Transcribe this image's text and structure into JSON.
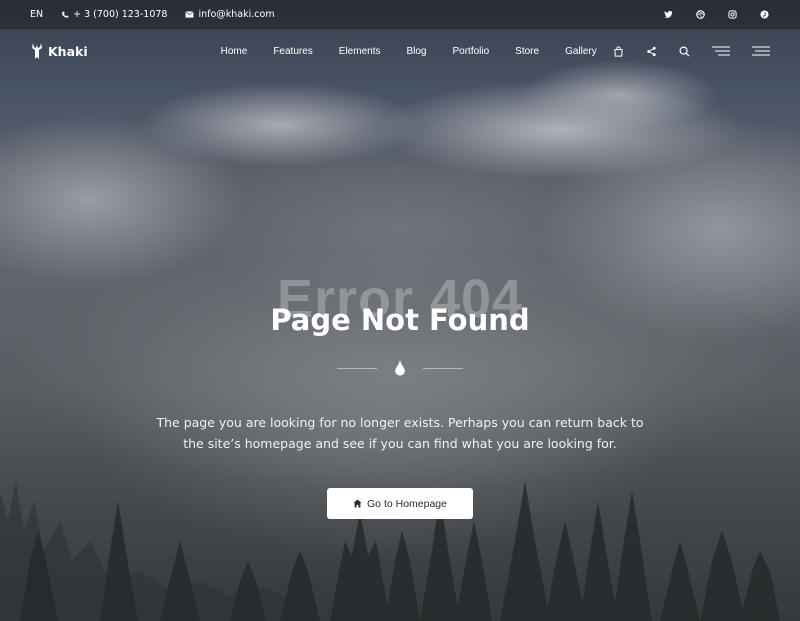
{
  "topbar": {
    "language": "EN",
    "phone": "+ 3 (700) 123-1078",
    "email": "info@khaki.com",
    "social_icons": [
      "twitter-icon",
      "dribbble-icon",
      "instagram-icon",
      "pinterest-icon"
    ]
  },
  "nav": {
    "brand": "Khaki",
    "items": [
      {
        "label": "Home"
      },
      {
        "label": "Features"
      },
      {
        "label": "Elements"
      },
      {
        "label": "Blog"
      },
      {
        "label": "Portfolio"
      },
      {
        "label": "Store"
      },
      {
        "label": "Gallery"
      }
    ],
    "icons": [
      "cart-icon",
      "share-icon",
      "search-icon",
      "side-menu-icon",
      "hamburger-menu-icon"
    ]
  },
  "hero": {
    "error_label": "Error 404",
    "title": "Page Not Found",
    "description": "The page you are looking for no longer exists. Perhaps you can return back to the site’s homepage and see if you can find what you are looking for.",
    "button_label": "Go to Homepage",
    "divider_icon": "drop-icon"
  },
  "colors": {
    "button_bg": "#ffffff",
    "button_text": "#2a2d33",
    "text": "#ffffff"
  }
}
